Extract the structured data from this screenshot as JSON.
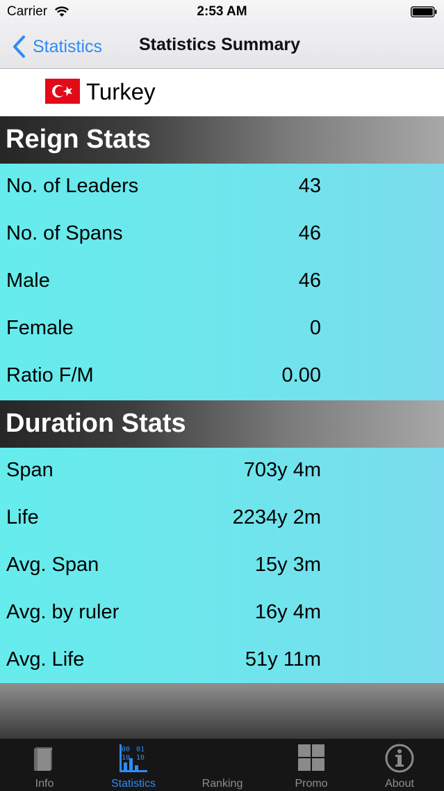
{
  "status_bar": {
    "carrier": "Carrier",
    "time": "2:53 AM"
  },
  "nav": {
    "back_label": "Statistics",
    "title": "Statistics Summary"
  },
  "country": {
    "name": "Turkey",
    "flag_icon": "turkey-flag-icon"
  },
  "reign_stats": {
    "title": "Reign Stats",
    "rows": [
      {
        "label": "No. of Leaders",
        "value": "43"
      },
      {
        "label": "No. of Spans",
        "value": "46"
      },
      {
        "label": "Male",
        "value": "46"
      },
      {
        "label": "Female",
        "value": "0"
      },
      {
        "label": "Ratio F/M",
        "value": "0.00"
      }
    ]
  },
  "duration_stats": {
    "title": "Duration Stats",
    "rows": [
      {
        "label": "Span",
        "value": "703y 4m"
      },
      {
        "label": "Life",
        "value": "2234y 2m"
      },
      {
        "label": "Avg. Span",
        "value": "15y 3m"
      },
      {
        "label": "Avg. by ruler",
        "value": "16y 4m"
      },
      {
        "label": "Avg. Life",
        "value": "51y 11m"
      }
    ]
  },
  "tabs": [
    {
      "label": "Info",
      "icon": "book-icon",
      "active": false
    },
    {
      "label": "Statistics",
      "icon": "statistics-icon",
      "active": true
    },
    {
      "label": "Ranking",
      "icon": "ranking-icon",
      "active": false
    },
    {
      "label": "Promo",
      "icon": "grid-icon",
      "active": false
    },
    {
      "label": "About",
      "icon": "info-icon",
      "active": false
    }
  ],
  "colors": {
    "accent": "#2f8bf5",
    "stat_background": "#66ecec",
    "flag_red": "#e30a17"
  }
}
